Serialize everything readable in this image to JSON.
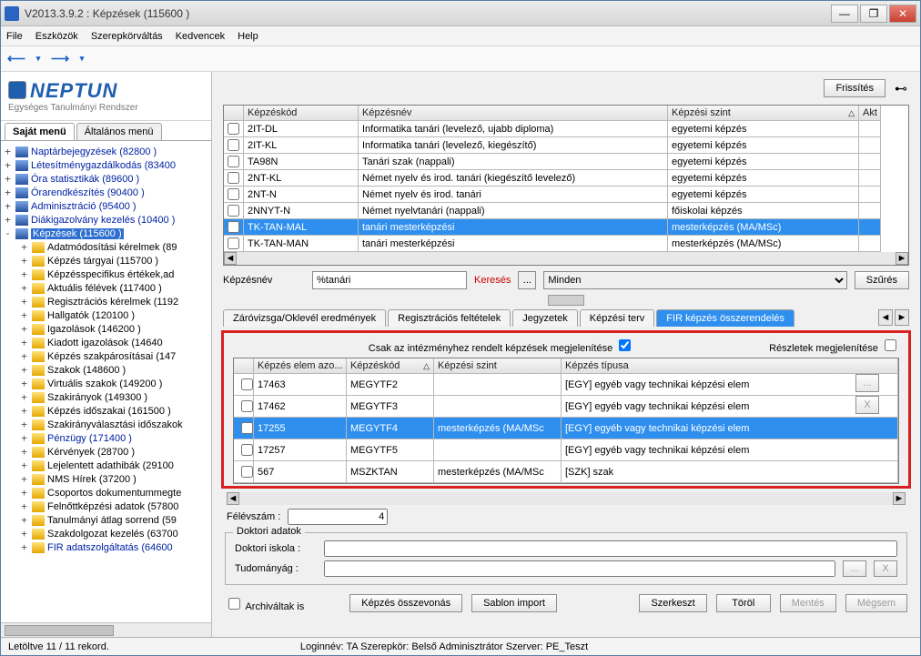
{
  "titlebar": {
    "title": "V2013.3.9.2 : Képzések (115600  )"
  },
  "menu": {
    "file": "File",
    "tools": "Eszközök",
    "role": "Szerepkörváltás",
    "fav": "Kedvencek",
    "help": "Help"
  },
  "logo": {
    "brand": "NEPTUN",
    "sub": "Egységes Tanulmányi Rendszer"
  },
  "lefttabs": {
    "own": "Saját menü",
    "gen": "Általános menü"
  },
  "tree_top": [
    {
      "t": "+",
      "i": "blue",
      "label": "Naptárbejegyzések (82800  )",
      "link": true
    },
    {
      "t": "+",
      "i": "blue",
      "label": "Létesítménygazdálkodás (83400",
      "link": true
    },
    {
      "t": "+",
      "i": "blue",
      "label": "Óra statisztikák (89600  )",
      "link": true
    },
    {
      "t": "+",
      "i": "blue",
      "label": "Órarendkészítés (90400  )",
      "link": true
    },
    {
      "t": "+",
      "i": "blue",
      "label": "Adminisztráció (95400  )",
      "link": true
    },
    {
      "t": "+",
      "i": "blue",
      "label": "Diákigazolvány kezelés (10400  )",
      "link": true
    }
  ],
  "tree_sel": {
    "t": "-",
    "i": "blue",
    "label": "Képzések  (115600  )"
  },
  "tree_children": [
    "Adatmódosítási kérelmek (89",
    "Képzés tárgyai (115700  )",
    "Képzésspecifikus értékek,ad",
    "Aktuális félévek (117400  )",
    "Regisztrációs kérelmek (1192",
    "Hallgatók (120100  )",
    "Igazolások (146200  )",
    "Kiadott igazolások (14640",
    "Képzés szakpárosításai (147",
    "Szakok (148600  )",
    "Virtuális szakok (149200  )",
    "Szakirányok (149300  )",
    "Képzés időszakai (161500  )",
    "Szakirányválasztási időszakok",
    "Pénzügy (171400  )",
    "Kérvények (28700  )",
    "Lejelentett adathibák (29100",
    "NMS Hírek (37200  )",
    "Csoportos dokumentummegte",
    "Felnőttképzési adatok (57800",
    "Tanulmányi átlag sorrend (59",
    "Szakdolgozat kezelés (63700",
    "FIR adatszolgáltatás (64600"
  ],
  "toprow": {
    "refresh": "Frissítés"
  },
  "grid1": {
    "h": {
      "code": "Képzéskód",
      "name": "Képzésnév",
      "level": "Képzési szint",
      "akt": "Akt"
    },
    "rows": [
      {
        "c": "2IT-DL",
        "n": "Informatika  tanári (levelező, ujabb diploma)",
        "l": "egyetemi képzés"
      },
      {
        "c": "2IT-KL",
        "n": "Informatika tanári (levelező, kiegészítő)",
        "l": "egyetemi képzés"
      },
      {
        "c": "TA98N",
        "n": "Tanári szak (nappali)",
        "l": "egyetemi képzés"
      },
      {
        "c": "2NT-KL",
        "n": "Német nyelv és irod. tanári (kiegészítő levelező)",
        "l": "egyetemi képzés"
      },
      {
        "c": "2NT-N",
        "n": "Német nyelv és irod. tanári",
        "l": "egyetemi képzés"
      },
      {
        "c": "2NNYT-N",
        "n": "Német nyelvtanári (nappali)",
        "l": "főiskolai képzés"
      },
      {
        "c": "TK-TAN-MAL",
        "n": "tanári mesterképzési",
        "l": "mesterképzés (MA/MSc)",
        "sel": true
      },
      {
        "c": "TK-TAN-MAN",
        "n": "tanári mesterképzési",
        "l": "mesterképzés (MA/MSc)"
      }
    ]
  },
  "search": {
    "label": "Képzésnév",
    "value": "%tanári",
    "btn": "Keresés",
    "dots": "...",
    "all": "Minden",
    "filter": "Szűrés"
  },
  "subtabs": {
    "t1": "Záróvizsga/Oklevél eredmények",
    "t2": "Regisztrációs feltételek",
    "t3": "Jegyzetek",
    "t4": "Képzési terv",
    "t5": "FIR képzés összerendelés"
  },
  "chkrow": {
    "label": "Csak az intézményhez rendelt képzések megjelenítése",
    "det": "Részletek megjelenítése"
  },
  "grid2": {
    "h": {
      "id": "Képzés elem azo...",
      "code": "Képzéskód",
      "level": "Képzési szint",
      "type": "Képzés típusa"
    },
    "rows": [
      {
        "id": "17463",
        "c": "MEGYTF2",
        "lv": "",
        "t": "[EGY] egyéb vagy technikai képzési elem"
      },
      {
        "id": "17462",
        "c": "MEGYTF3",
        "lv": "",
        "t": "[EGY] egyéb vagy technikai képzési elem"
      },
      {
        "id": "17255",
        "c": "MEGYTF4",
        "lv": "mesterképzés (MA/MSc",
        "t": "[EGY] egyéb vagy technikai képzési elem",
        "sel": true
      },
      {
        "id": "17257",
        "c": "MEGYTF5",
        "lv": "",
        "t": "[EGY] egyéb vagy technikai képzési elem"
      },
      {
        "id": "567",
        "c": "MSZKTAN",
        "lv": "mesterképzés (MA/MSc",
        "t": "[SZK] szak"
      }
    ]
  },
  "semester": {
    "label": "Félévszám :",
    "value": "4"
  },
  "doctoral": {
    "legend": "Doktori adatok",
    "school": "Doktori iskola :",
    "disc": "Tudományág :",
    "dots": "...",
    "x": "X"
  },
  "bottom": {
    "arch": "Archiváltak is",
    "merge": "Képzés összevonás",
    "tmpl": "Sablon import",
    "edit": "Szerkeszt",
    "del": "Töröl",
    "save": "Mentés",
    "cancel": "Mégsem"
  },
  "status": {
    "rec": "Letöltve 11 / 11 rekord.",
    "login": "Loginnév: TA   Szerepkör: Belső Adminisztrátor   Szerver: PE_Teszt"
  }
}
